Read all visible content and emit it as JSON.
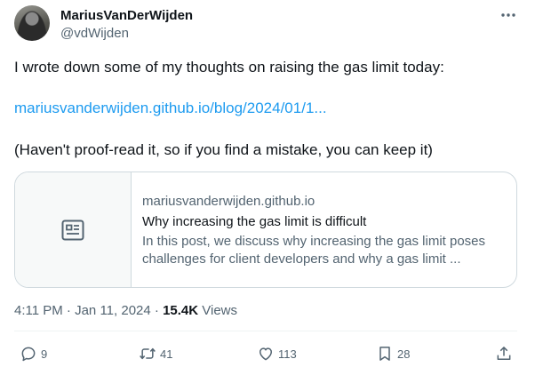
{
  "author": {
    "name": "MariusVanDerWijden",
    "handle": "@vdWijden"
  },
  "tweet": {
    "line1": "I wrote down some of my thoughts on raising the gas limit today:",
    "link": "mariusvanderwijden.github.io/blog/2024/01/1...",
    "line3": "(Haven't proof-read it, so if you find a mistake, you can keep it)"
  },
  "card": {
    "domain": "mariusvanderwijden.github.io",
    "title": "Why increasing the gas limit is difficult",
    "desc_line1": "In this post, we discuss why increasing the gas limit poses",
    "desc_line2": "challenges for client developers and why a gas limit ...",
    "thumb_icon": "article-icon"
  },
  "meta": {
    "time": "4:11 PM",
    "separator1": " · ",
    "date": "Jan 11, 2024",
    "separator2": " · ",
    "views": "15.4K",
    "views_label": " Views"
  },
  "actions": {
    "replies": "9",
    "reposts": "41",
    "likes": "113",
    "bookmarks": "28"
  },
  "colors": {
    "link": "#1d9bf0",
    "secondary_text": "#536471",
    "border": "#cfd9de"
  }
}
